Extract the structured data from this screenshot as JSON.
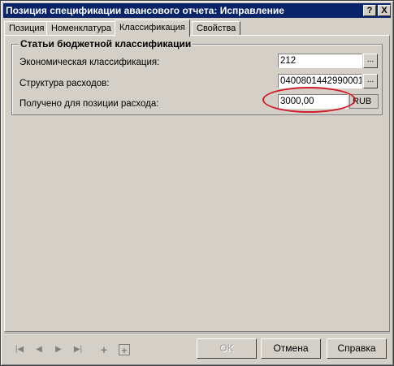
{
  "window": {
    "title": "Позиция спецификации авансового отчета: Исправление",
    "help_btn": "?",
    "close_btn": "X"
  },
  "tabs": [
    {
      "label": "Позиция"
    },
    {
      "label": "Номенклатура"
    },
    {
      "label": "Классификация",
      "active": true
    },
    {
      "label": "Свойства"
    }
  ],
  "group": {
    "title": "Статьи бюджетной классификации",
    "rows": [
      {
        "label": "Экономическая классификация:",
        "value": "212"
      },
      {
        "label": "Структура расходов:",
        "value": "0400801442990001"
      },
      {
        "label": "Получено для позиции расхода:",
        "value": "3000,00",
        "currency": "RUB"
      }
    ],
    "ellipsis": "..."
  },
  "nav_icons": [
    "first-record-icon",
    "prev-record-icon",
    "next-record-icon",
    "last-record-icon",
    "add-icon",
    "add-copy-icon"
  ],
  "buttons": {
    "ok": "OK",
    "cancel": "Отмена",
    "help": "Справка"
  },
  "colors": {
    "titlebar": "#0a246a",
    "highlight_ellipse": "#d01c2b"
  }
}
